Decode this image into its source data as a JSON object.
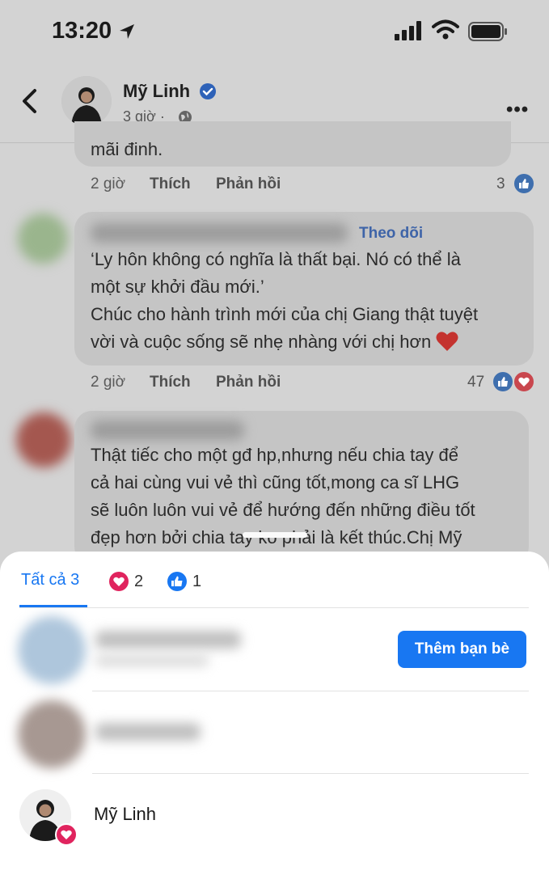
{
  "status_bar": {
    "time": "13:20"
  },
  "header": {
    "name": "Mỹ Linh",
    "time": "3 giờ",
    "separator": "·",
    "more": "•••"
  },
  "comments": [
    {
      "text_lines": [
        "mãi đinh."
      ],
      "time": "2 giờ",
      "like": "Thích",
      "reply": "Phản hồi",
      "reaction_count": "3"
    },
    {
      "follow": "Theo dõi",
      "text_lines": [
        "‘Ly hôn không có nghĩa là thất bại. Nó có thể là",
        "một sự khởi đầu mới.’",
        "Chúc cho hành trình mới của chị Giang thật tuyệt",
        "vời và cuộc sống sẽ nhẹ nhàng với chị hơn"
      ],
      "time": "2 giờ",
      "like": "Thích",
      "reply": "Phản hồi",
      "reaction_count": "47"
    },
    {
      "text_lines": [
        "Thật tiếc cho một gđ hp,nhưng nếu chia tay để",
        "cả hai cùng vui vẻ thì cũng tốt,mong ca sĩ LHG",
        "sẽ luôn luôn vui vẻ để hướng đến những điều tốt",
        "đẹp hơn bởi chia tay ko phải là kết thúc.Chị Mỹ"
      ]
    }
  ],
  "reactions_sheet": {
    "tabs": [
      {
        "label": "Tất cả 3"
      },
      {
        "icon": "heart-icon",
        "count": "2"
      },
      {
        "icon": "like-icon",
        "count": "1"
      }
    ],
    "add_friend_label": "Thêm bạn bè",
    "people": [
      {
        "name": "Mỹ Linh"
      }
    ]
  },
  "colors": {
    "accent": "#1877f2",
    "heart": "#e0245e"
  }
}
